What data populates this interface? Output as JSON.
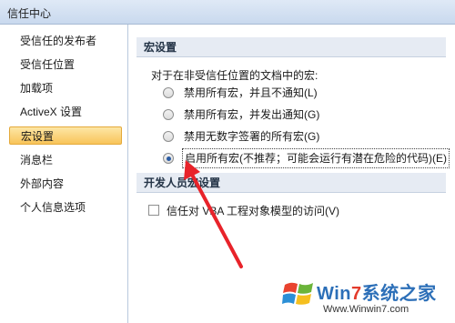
{
  "window": {
    "title": "信任中心"
  },
  "sidebar": {
    "items": [
      {
        "label": "受信任的发布者",
        "active": false
      },
      {
        "label": "受信任位置",
        "active": false
      },
      {
        "label": "加载项",
        "active": false
      },
      {
        "label": "ActiveX 设置",
        "active": false
      },
      {
        "label": "宏设置",
        "active": true
      },
      {
        "label": "消息栏",
        "active": false
      },
      {
        "label": "外部内容",
        "active": false
      },
      {
        "label": "个人信息选项",
        "active": false
      }
    ]
  },
  "macro_settings": {
    "header": "宏设置",
    "group_label": "对于在非受信任位置的文档中的宏:",
    "options": [
      {
        "label": "禁用所有宏，并且不通知(L)",
        "checked": false
      },
      {
        "label": "禁用所有宏，并发出通知(G)",
        "checked": false
      },
      {
        "label": "禁用无数字签署的所有宏(G)",
        "checked": false
      },
      {
        "label": "启用所有宏(不推荐；可能会运行有潜在危险的代码)(E)",
        "checked": true
      }
    ]
  },
  "developer": {
    "header": "开发人员宏设置",
    "checkbox_label": "信任对 VBA 工程对象模型的访问(V)",
    "checked": false
  },
  "watermark": {
    "brand_prefix": "Win",
    "brand_seven": "7",
    "brand_suffix": "系统之家",
    "url": "Www.Winwin7.com"
  },
  "colors": {
    "annotation_arrow": "#e8232a",
    "selected_item": "#f8c45a",
    "section_header_bg": "#e6ebf3"
  }
}
